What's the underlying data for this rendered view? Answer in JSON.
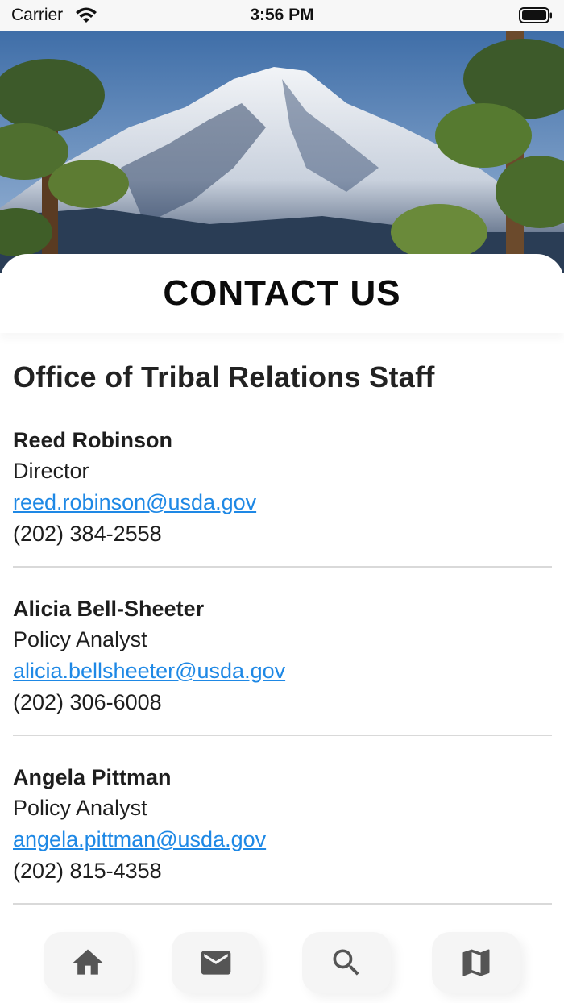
{
  "status_bar": {
    "carrier": "Carrier",
    "time": "3:56 PM"
  },
  "header": {
    "title": "CONTACT US"
  },
  "section": {
    "title": "Office of Tribal Relations Staff"
  },
  "contacts": [
    {
      "name": "Reed Robinson",
      "role": "Director",
      "email": "reed.robinson@usda.gov",
      "phone": "(202) 384-2558"
    },
    {
      "name": "Alicia Bell-Sheeter",
      "role": "Policy Analyst",
      "email": "alicia.bellsheeter@usda.gov",
      "phone": "(202) 306-6008"
    },
    {
      "name": "Angela Pittman",
      "role": "Policy Analyst",
      "email": "angela.pittman@usda.gov",
      "phone": "(202) 815-4358"
    }
  ],
  "bottom_nav": [
    {
      "icon": "home-icon"
    },
    {
      "icon": "mail-icon"
    },
    {
      "icon": "search-icon"
    },
    {
      "icon": "map-icon"
    }
  ],
  "colors": {
    "link": "#1e88e5",
    "text": "#1e1e1e",
    "nav_icon": "#555555"
  }
}
